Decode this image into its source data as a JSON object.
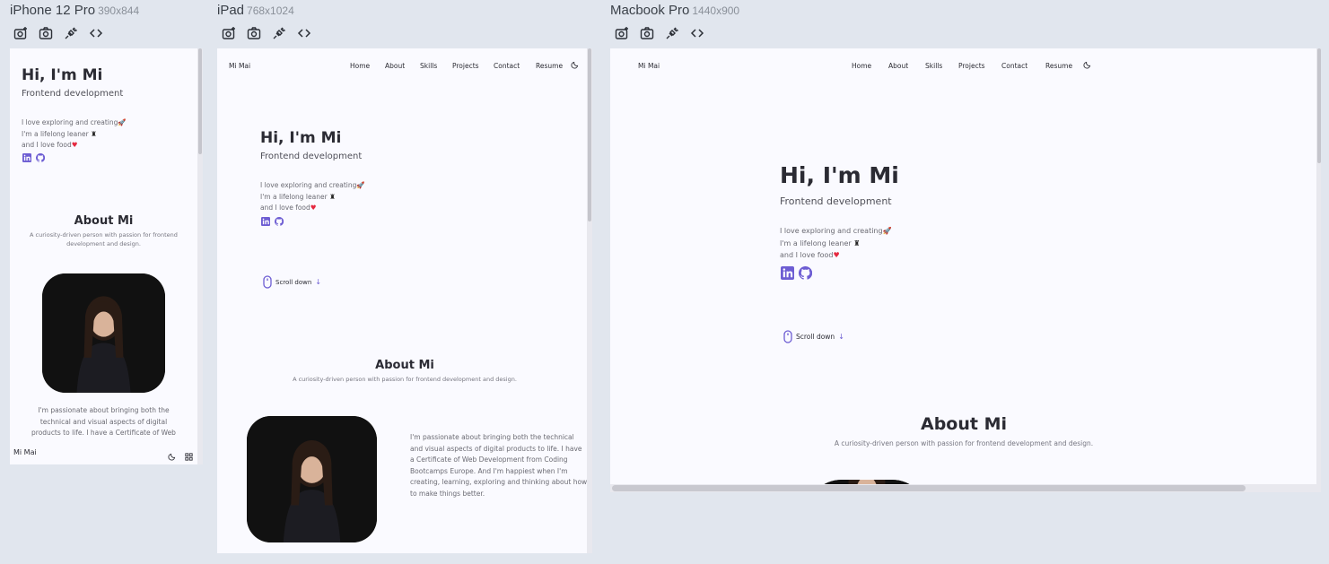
{
  "devices": [
    {
      "name": "iPhone 12 Pro",
      "dims": "390x844"
    },
    {
      "name": "iPad",
      "dims": "768x1024"
    },
    {
      "name": "Macbook Pro",
      "dims": "1440x900"
    }
  ],
  "toolbar_icons": [
    "camera-plus-icon",
    "camera-icon",
    "plug-icon",
    "code-icon"
  ],
  "site": {
    "brand": "Mi Mai",
    "nav": [
      "Home",
      "About",
      "Skills",
      "Projects",
      "Contact",
      "Resume"
    ],
    "hero_title": "Hi, I'm Mi",
    "hero_subtitle": "Frontend development",
    "lines": [
      "I love exploring and creating",
      "I'm a lifelong leaner",
      "and I love food"
    ],
    "scroll": "Scroll down",
    "about_title": "About Mi",
    "about_subtitle": "A curiosity-driven person with passion for frontend development and design.",
    "about_text": "I'm passionate about bringing both the technical and visual aspects of digital products to life. I have a Certificate of Web Development from Coding Bootcamps Europe. And I'm happiest when I'm creating, learning, exploring and thinking about how to make things better.",
    "about_text_phone": "I'm passionate about bringing both the technical and visual aspects of digital products to life. I have a Certificate of Web",
    "colors": {
      "accent": "#6d5dd3",
      "bg": "#fafaff",
      "heart": "#e5283f"
    }
  }
}
